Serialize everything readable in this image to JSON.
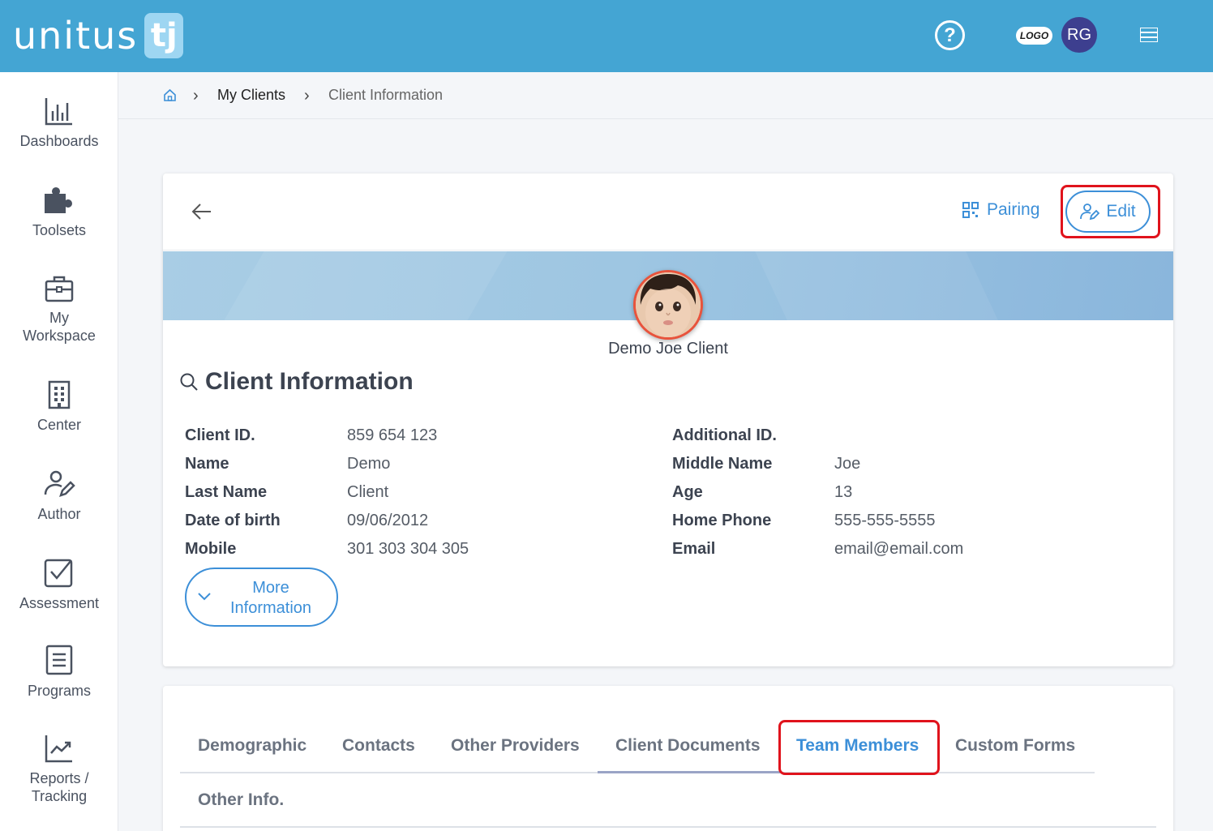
{
  "header": {
    "logo_text": "unitus",
    "logo_mark": "tj",
    "org_logo_text": "LOGO",
    "user_initials": "RG",
    "icons": [
      "help-icon",
      "menu-icon"
    ],
    "colors": {
      "bar": "#44a5d3",
      "avatar": "#3d3f8f"
    }
  },
  "sidebar": {
    "items": [
      {
        "label": "Dashboards",
        "icon": "bar-chart-icon"
      },
      {
        "label": "Toolsets",
        "icon": "puzzle-icon"
      },
      {
        "label": "My Workspace",
        "icon": "briefcase-icon"
      },
      {
        "label": "Center",
        "icon": "building-icon"
      },
      {
        "label": "Author",
        "icon": "author-icon"
      },
      {
        "label": "Assessment",
        "icon": "checkbox-icon"
      },
      {
        "label": "Programs",
        "icon": "document-icon"
      },
      {
        "label": "Reports / Tracking",
        "icon": "trend-chart-icon"
      }
    ]
  },
  "breadcrumb": {
    "items": [
      "My Clients",
      "Client Information"
    ]
  },
  "card": {
    "pairing_label": "Pairing",
    "edit_label": "Edit",
    "client_name": "Demo Joe Client",
    "section_title": "Client Information",
    "left_fields": [
      {
        "label": "Client ID.",
        "value": "859 654 123"
      },
      {
        "label": "Name",
        "value": "Demo"
      },
      {
        "label": "Last Name",
        "value": "Client"
      },
      {
        "label": "Date of birth",
        "value": "09/06/2012"
      },
      {
        "label": "Mobile",
        "value": "301 303 304 305"
      }
    ],
    "right_fields": [
      {
        "label": "Additional ID.",
        "value": ""
      },
      {
        "label": "Middle Name",
        "value": "Joe"
      },
      {
        "label": "Age",
        "value": "13"
      },
      {
        "label": "Home Phone",
        "value": "555-555-5555"
      },
      {
        "label": "Email",
        "value": "email@email.com"
      }
    ],
    "more_button_line1": "More",
    "more_button_line2": "Information"
  },
  "tabs": {
    "items": [
      "Demographic",
      "Contacts",
      "Other Providers",
      "Client Documents",
      "Team Members",
      "Custom Forms",
      "Other Info."
    ],
    "active": "Team Members"
  },
  "accent_color": "#3c8fd8",
  "highlight_color": "#e0131c"
}
